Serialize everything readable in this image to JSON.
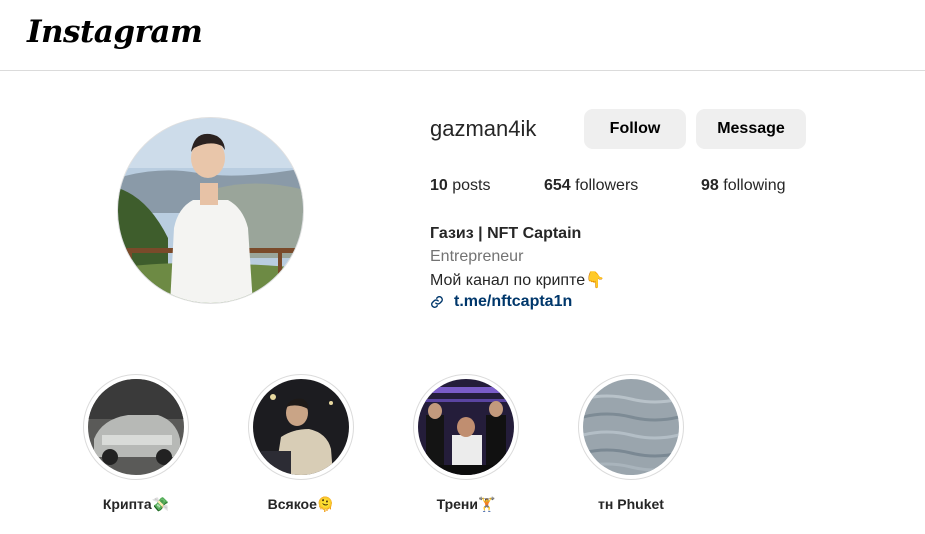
{
  "app": {
    "logo_text": "Instagram"
  },
  "profile": {
    "username": "gazman4ik",
    "follow_label": "Follow",
    "message_label": "Message",
    "stats": {
      "posts": "10",
      "posts_label": " posts",
      "followers": "654",
      "followers_label": " followers",
      "following": "98",
      "following_label": " following"
    },
    "full_name": "Газиз | NFT Captain",
    "category": "Entrepreneur",
    "bio": "Мой канал по крипте👇",
    "link": "t.me/nftcapta1n"
  },
  "highlights": [
    {
      "label": "Крипта💸"
    },
    {
      "label": "Всякое🫠"
    },
    {
      "label": "Трени🏋"
    },
    {
      "label": "тн Phuket"
    }
  ],
  "colors": {
    "border": "#dbdbdb",
    "button_bg": "#efefef",
    "link": "#00376b",
    "secondary_text": "#737373"
  },
  "icons": {
    "link": "link-chain-icon"
  }
}
